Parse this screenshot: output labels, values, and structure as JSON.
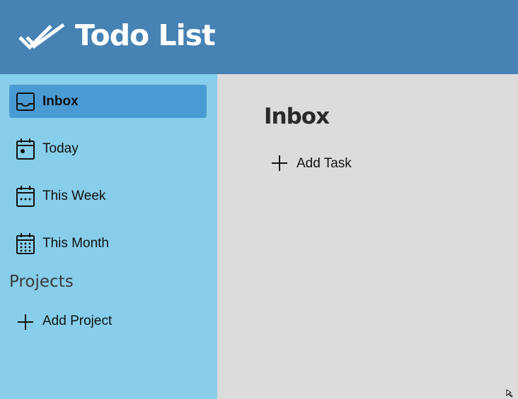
{
  "header": {
    "app_title": "Todo List",
    "logo_icon": "double-check-icon",
    "background": "#4682b4"
  },
  "sidebar": {
    "background": "#87ceeb",
    "active_color": "#4a9bd4",
    "items": [
      {
        "label": "Inbox",
        "icon": "inbox-tray-icon",
        "active": true
      },
      {
        "label": "Today",
        "icon": "calendar-day-icon",
        "active": false
      },
      {
        "label": "This Week",
        "icon": "calendar-week-icon",
        "active": false
      },
      {
        "label": "This Month",
        "icon": "calendar-month-icon",
        "active": false
      }
    ],
    "projects_heading": "Projects",
    "add_project_label": "Add Project"
  },
  "main": {
    "page_title": "Inbox",
    "add_task_label": "Add Task",
    "background": "#dcdcdc"
  }
}
